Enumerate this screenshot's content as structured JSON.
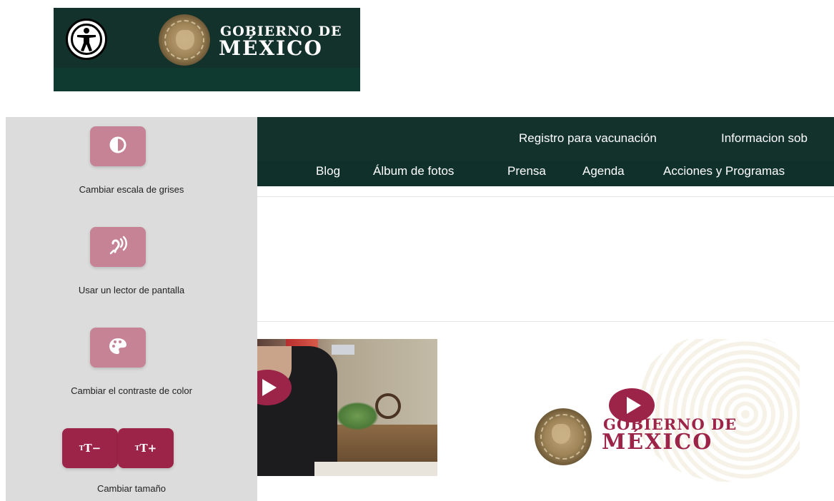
{
  "gov_banner": {
    "gobierno": "GOBIERNO DE",
    "mexico": "MÉXICO",
    "accessibility_icon": "accessibility-person-icon"
  },
  "nav": {
    "top_links": [
      "Registro para vacunación",
      "Informacion sob"
    ],
    "sub_links": [
      "Blog",
      "Álbum de fotos",
      "Prensa",
      "Agenda",
      "Acciones y Programas"
    ]
  },
  "accessibility_panel": {
    "grayscale": {
      "label": "Cambiar escala de grises",
      "icon": "half-circle-contrast-icon"
    },
    "screen_reader": {
      "label": "Usar un lector de pantalla",
      "icon": "hearing-icon"
    },
    "contrast": {
      "label": "Cambiar el contraste de color",
      "icon": "palette-icon"
    },
    "size": {
      "label": "Cambiar tamaño",
      "decrease": "T−",
      "increase": "T+"
    }
  },
  "video_thumbnail": {
    "gobierno": "GOBIERNO DE",
    "mexico": "MÉXICO"
  },
  "colors": {
    "dark_green": "#13322b",
    "guinda": "#9d2449",
    "panel_gray": "#dcdcdc",
    "tool_pink": "#c58395"
  }
}
